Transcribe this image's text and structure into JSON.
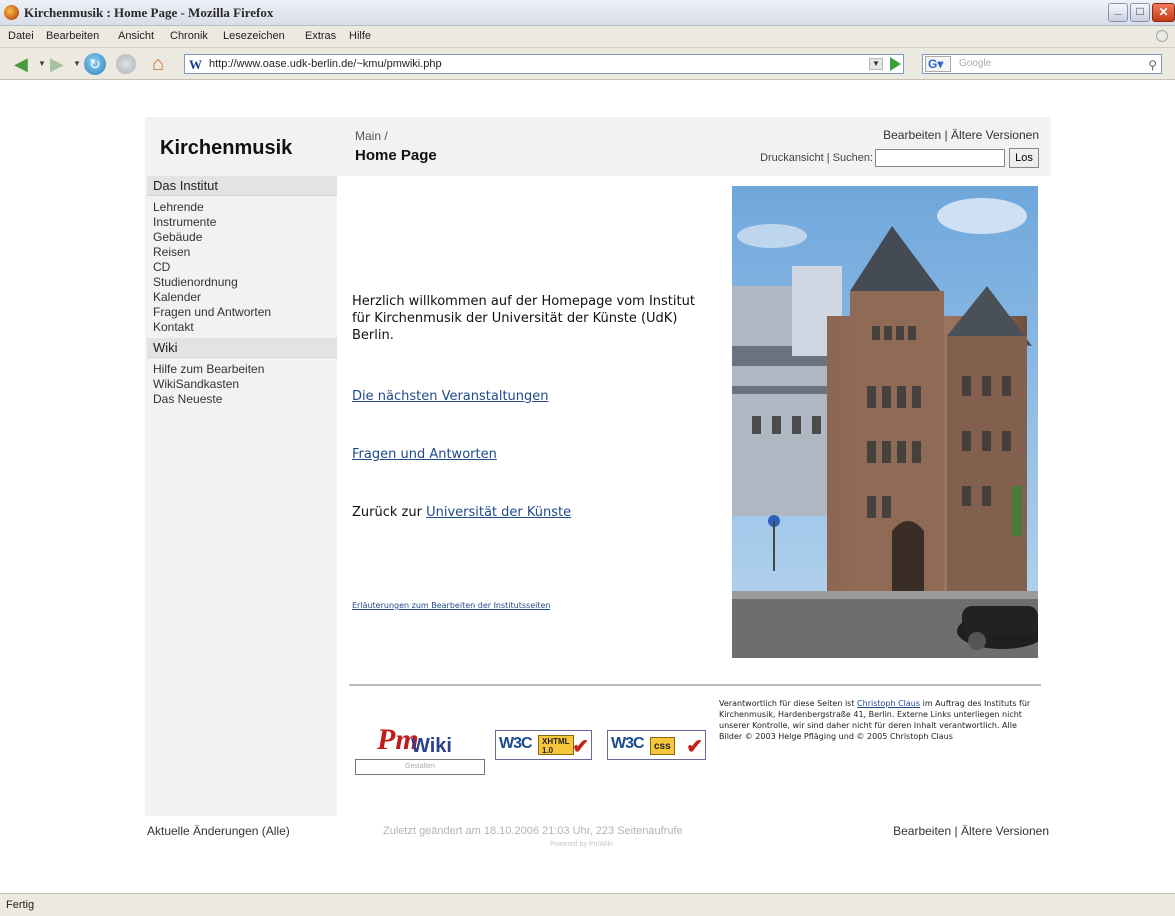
{
  "window": {
    "title": "Kirchenmusik : Home Page - Mozilla Firefox"
  },
  "menu": [
    "Datei",
    "Bearbeiten",
    "Ansicht",
    "Chronik",
    "Lesezeichen",
    "Extras",
    "Hilfe"
  ],
  "toolbar": {
    "url": "http://www.oase.udk-berlin.de/~kmu/pmwiki.php",
    "url_favicon": "W",
    "search_engine": "G",
    "search_placeholder": "Google"
  },
  "page": {
    "site_title": "Kirchenmusik",
    "group": "Main /",
    "title": "Home Page",
    "actions": {
      "edit": "Bearbeiten",
      "sep": " | ",
      "history": "Ältere Versionen"
    },
    "print": "Druckansicht",
    "search_sep": " | ",
    "search_label": "Suchen:",
    "search_value": "",
    "search_button": "Los",
    "sidebar": {
      "section1": "Das Institut",
      "items1": [
        "Lehrende",
        "Instrumente",
        "Gebäude",
        "Reisen",
        "CD",
        "Studienordnung",
        "Kalender",
        "Fragen und Antworten",
        "Kontakt"
      ],
      "section2": "Wiki",
      "items2": [
        "Hilfe zum Bearbeiten",
        "WikiSandkasten",
        "Das Neueste"
      ]
    },
    "content": {
      "welcome": "Herzlich willkommen auf der Homepage vom Institut für Kirchenmusik der Universität der Künste (UdK) Berlin.",
      "link_events": "Die nächsten Veranstaltungen",
      "link_faq": "Fragen und Antworten",
      "back_prefix": "Zurück zur ",
      "back_link": "Universität der Künste",
      "note_link": "Erläuterungen zum Bearbeiten der Institutsseiten"
    },
    "badges": {
      "pmwiki_pm": "Pm",
      "pmwiki_wiki": "Wiki",
      "pmwiki_form": "Gestalten",
      "w3c": "W3C",
      "xhtml_line1": "XHTML",
      "xhtml_line2": "1.0",
      "css": "css"
    },
    "imprint": {
      "prefix": "Verantwortlich für diese Seiten ist ",
      "person": "Christoph Claus",
      "rest": " im Auftrag des Instituts für Kirchenmusik, Hardenbergstraße 41, Berlin. Externe Links unterliegen nicht unserer Kontrolle, wir sind daher nicht für deren Inhalt verantwortlich. Alle Bilder © 2003 Helge Pfläging und © 2005 Christoph Claus"
    },
    "footer": {
      "recent": "Aktuelle Änderungen (Alle)",
      "modified": "Zuletzt geändert am 18.10.2006 21:03 Uhr, 223 Seitenaufrufe",
      "powered": "Powered by PmWiki"
    }
  },
  "status": "Fertig"
}
